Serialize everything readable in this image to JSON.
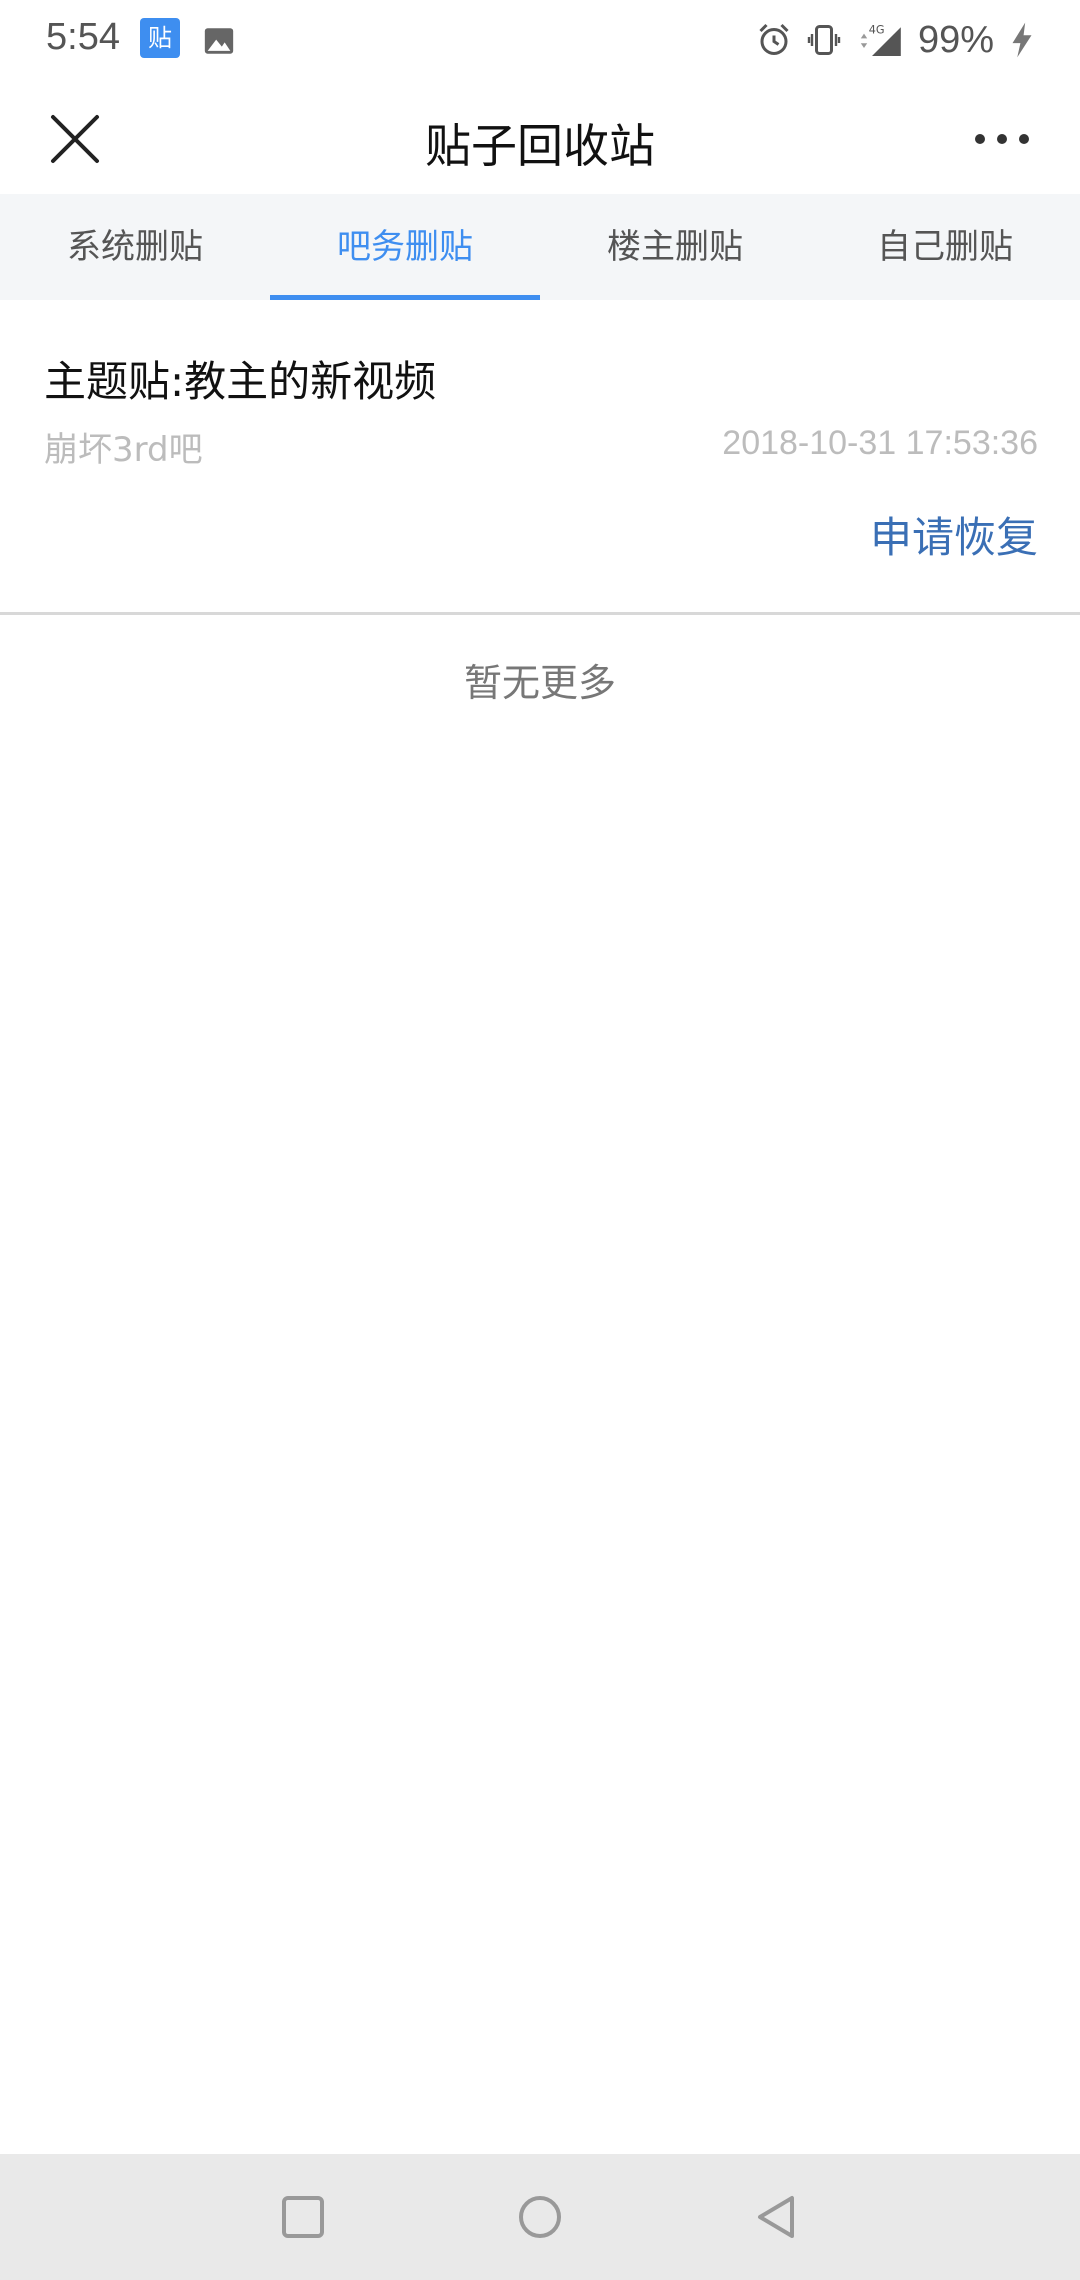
{
  "status_bar": {
    "time": "5:54",
    "app_badge": "贴",
    "battery": "99%",
    "network": "4G",
    "icons": [
      "tieba-app-icon",
      "gallery-icon",
      "alarm-icon",
      "vibrate-icon",
      "signal-icon",
      "charging-icon"
    ]
  },
  "header": {
    "title": "贴子回收站",
    "close_icon": "close-icon",
    "more_icon": "more-icon"
  },
  "tabs": [
    {
      "label": "系统删贴",
      "active": false
    },
    {
      "label": "吧务删贴",
      "active": true
    },
    {
      "label": "楼主删贴",
      "active": false
    },
    {
      "label": "自己删贴",
      "active": false
    }
  ],
  "posts": [
    {
      "title": "主题贴:教主的新视频",
      "forum": "崩坏3rd吧",
      "time": "2018-10-31 17:53:36",
      "action": "申请恢复"
    }
  ],
  "list_footer": "暂无更多",
  "colors": {
    "accent": "#3e8ef0",
    "action": "#3a6fb5",
    "tab_bg": "#f4f6f8",
    "nav_bg": "#e9e9e9"
  },
  "nav": {
    "icons": [
      "recents-icon",
      "home-icon",
      "back-icon"
    ]
  }
}
